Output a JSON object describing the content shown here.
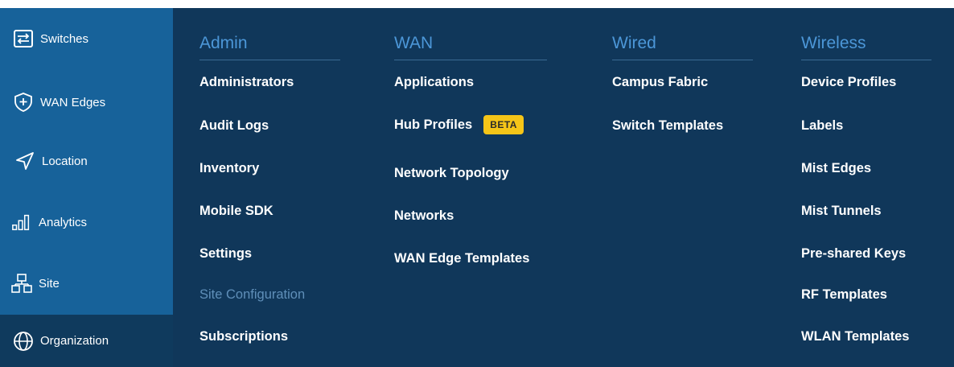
{
  "sidebar": {
    "items": [
      {
        "label": "Switches",
        "icon": "switches-icon"
      },
      {
        "label": "WAN Edges",
        "icon": "wan-edges-shield-icon"
      },
      {
        "label": "Location",
        "icon": "location-arrow-icon"
      },
      {
        "label": "Analytics",
        "icon": "analytics-bars-icon"
      },
      {
        "label": "Site",
        "icon": "site-hierarchy-icon"
      },
      {
        "label": "Organization",
        "icon": "globe-icon",
        "active": true
      }
    ]
  },
  "menu": {
    "columns": [
      {
        "title": "Admin",
        "items": [
          "Administrators",
          "Audit Logs",
          "Inventory",
          "Mobile SDK",
          "Settings",
          "Site Configuration",
          "Subscriptions"
        ]
      },
      {
        "title": "WAN",
        "items": [
          "Applications",
          "Hub Profiles",
          "Network Topology",
          "Networks",
          "WAN Edge Templates"
        ],
        "badge": "BETA"
      },
      {
        "title": "Wired",
        "items": [
          "Campus Fabric",
          "Switch Templates"
        ]
      },
      {
        "title": "Wireless",
        "items": [
          "Device Profiles",
          "Labels",
          "Mist Edges",
          "Mist Tunnels",
          "Pre-shared Keys",
          "RF Templates",
          "WLAN Templates"
        ]
      }
    ]
  },
  "colors": {
    "sidebar_bg": "#17629a",
    "sidebar_active_bg": "#0f3a5d",
    "menu_bg": "#10375a",
    "column_title": "#4c97d8",
    "muted_item": "#5f8fb9",
    "badge_bg": "#f5c518"
  }
}
